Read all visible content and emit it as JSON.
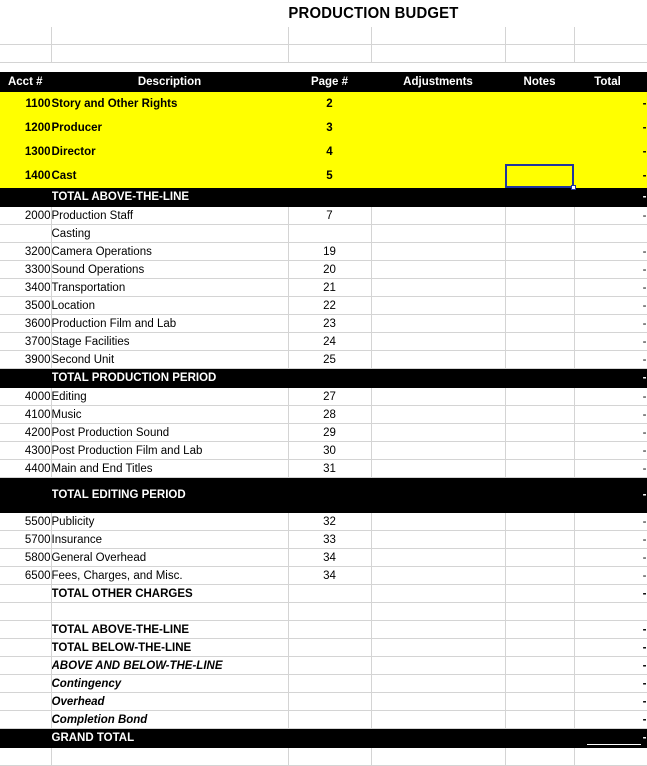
{
  "title": "PRODUCTION BUDGET",
  "columns": {
    "acct": "Acct #",
    "description": "Description",
    "page": "Page #",
    "adjustments": "Adjustments",
    "notes": "Notes",
    "total": "Total"
  },
  "colors": {
    "above_the_line_fill": "#ffff00",
    "total_bar_fill": "#000000",
    "total_bar_text": "#ffffff",
    "grid_line": "#d4d4d4",
    "selection_border": "#1f35a0"
  },
  "selection": {
    "cell": "notes-cast-row",
    "column": "Notes",
    "row_label": "Cast",
    "value": ""
  },
  "rows": [
    {
      "kind": "colhead"
    },
    {
      "kind": "atl",
      "acct": "1100",
      "description": "Story and Other Rights",
      "page": "2",
      "adjustments": "",
      "notes": "",
      "total": "-"
    },
    {
      "kind": "atl",
      "acct": "1200",
      "description": "Producer",
      "page": "3",
      "adjustments": "",
      "notes": "",
      "total": "-"
    },
    {
      "kind": "atl",
      "acct": "1300",
      "description": "Director",
      "page": "4",
      "adjustments": "",
      "notes": "",
      "total": "-"
    },
    {
      "kind": "atl",
      "acct": "1400",
      "description": "Cast",
      "page": "5",
      "adjustments": "",
      "notes": "",
      "total": "-"
    },
    {
      "kind": "totalbar",
      "acct": "",
      "description": "TOTAL ABOVE-THE-LINE",
      "page": "",
      "adjustments": "",
      "notes": "",
      "total": "-"
    },
    {
      "kind": "normal",
      "acct": "2000",
      "description": "Production Staff",
      "page": "7",
      "adjustments": "",
      "notes": "",
      "total": "-"
    },
    {
      "kind": "normal",
      "acct": "",
      "description": "Casting",
      "page": "",
      "adjustments": "",
      "notes": "",
      "total": ""
    },
    {
      "kind": "normal",
      "acct": "3200",
      "description": "Camera Operations",
      "page": "19",
      "adjustments": "",
      "notes": "",
      "total": "-"
    },
    {
      "kind": "normal",
      "acct": "3300",
      "description": "Sound Operations",
      "page": "20",
      "adjustments": "",
      "notes": "",
      "total": "-"
    },
    {
      "kind": "normal",
      "acct": "3400",
      "description": "Transportation",
      "page": "21",
      "adjustments": "",
      "notes": "",
      "total": "-"
    },
    {
      "kind": "normal",
      "acct": "3500",
      "description": "Location",
      "page": "22",
      "adjustments": "",
      "notes": "",
      "total": "-"
    },
    {
      "kind": "normal",
      "acct": "3600",
      "description": "Production Film and Lab",
      "page": "23",
      "adjustments": "",
      "notes": "",
      "total": "-"
    },
    {
      "kind": "normal",
      "acct": "3700",
      "description": "Stage Facilities",
      "page": "24",
      "adjustments": "",
      "notes": "",
      "total": "-"
    },
    {
      "kind": "normal",
      "acct": "3900",
      "description": "Second Unit",
      "page": "25",
      "adjustments": "",
      "notes": "",
      "total": "-"
    },
    {
      "kind": "totalbar",
      "acct": "",
      "description": "TOTAL PRODUCTION PERIOD",
      "page": "",
      "adjustments": "",
      "notes": "",
      "total": "-"
    },
    {
      "kind": "normal",
      "acct": "4000",
      "description": "Editing",
      "page": "27",
      "adjustments": "",
      "notes": "",
      "total": "-"
    },
    {
      "kind": "normal",
      "acct": "4100",
      "description": "Music",
      "page": "28",
      "adjustments": "",
      "notes": "",
      "total": "-"
    },
    {
      "kind": "normal",
      "acct": "4200",
      "description": "Post Production Sound",
      "page": "29",
      "adjustments": "",
      "notes": "",
      "total": "-"
    },
    {
      "kind": "normal",
      "acct": "4300",
      "description": "Post Production Film and Lab",
      "page": "30",
      "adjustments": "",
      "notes": "",
      "total": "-"
    },
    {
      "kind": "normal",
      "acct": "4400",
      "description": "Main and End Titles",
      "page": "31",
      "adjustments": "",
      "notes": "",
      "total": "-"
    },
    {
      "kind": "totalbar-tall",
      "acct": "",
      "description": "TOTAL EDITING PERIOD",
      "page": "",
      "adjustments": "",
      "notes": "",
      "total": "-"
    },
    {
      "kind": "normal",
      "acct": "5500",
      "description": "Publicity",
      "page": "32",
      "adjustments": "",
      "notes": "",
      "total": "-"
    },
    {
      "kind": "normal",
      "acct": "5700",
      "description": "Insurance",
      "page": "33",
      "adjustments": "",
      "notes": "",
      "total": "-"
    },
    {
      "kind": "normal",
      "acct": "5800",
      "description": "General Overhead",
      "page": "34",
      "adjustments": "",
      "notes": "",
      "total": "-"
    },
    {
      "kind": "normal",
      "acct": "6500",
      "description": "Fees, Charges, and Misc.",
      "page": "34",
      "adjustments": "",
      "notes": "",
      "total": "-"
    },
    {
      "kind": "totalplain",
      "acct": "",
      "description": "TOTAL OTHER CHARGES",
      "page": "",
      "adjustments": "",
      "notes": "",
      "total": "-"
    },
    {
      "kind": "spacer",
      "acct": "",
      "description": "",
      "page": "",
      "adjustments": "",
      "notes": "",
      "total": ""
    },
    {
      "kind": "totalplain",
      "acct": "",
      "description": "TOTAL ABOVE-THE-LINE",
      "page": "",
      "adjustments": "",
      "notes": "",
      "total": "-"
    },
    {
      "kind": "totalplain",
      "acct": "",
      "description": "TOTAL BELOW-THE-LINE",
      "page": "",
      "adjustments": "",
      "notes": "",
      "total": "-"
    },
    {
      "kind": "italicrow",
      "acct": "",
      "description": "ABOVE AND BELOW-THE-LINE",
      "page": "",
      "adjustments": "",
      "notes": "",
      "total": "-"
    },
    {
      "kind": "italicrow",
      "acct": "",
      "description": "Contingency",
      "page": "",
      "adjustments": "",
      "notes": "",
      "total": "-"
    },
    {
      "kind": "italicrow",
      "acct": "",
      "description": "Overhead",
      "page": "",
      "adjustments": "",
      "notes": "",
      "total": "-"
    },
    {
      "kind": "italicrow",
      "acct": "",
      "description": "Completion Bond",
      "page": "",
      "adjustments": "",
      "notes": "",
      "total": "-"
    },
    {
      "kind": "grand",
      "acct": "",
      "description": "GRAND TOTAL",
      "page": "",
      "adjustments": "",
      "notes": "",
      "total": "-"
    },
    {
      "kind": "spacer",
      "acct": "",
      "description": "",
      "page": "",
      "adjustments": "",
      "notes": "",
      "total": ""
    }
  ],
  "top_blank_rows": 2
}
